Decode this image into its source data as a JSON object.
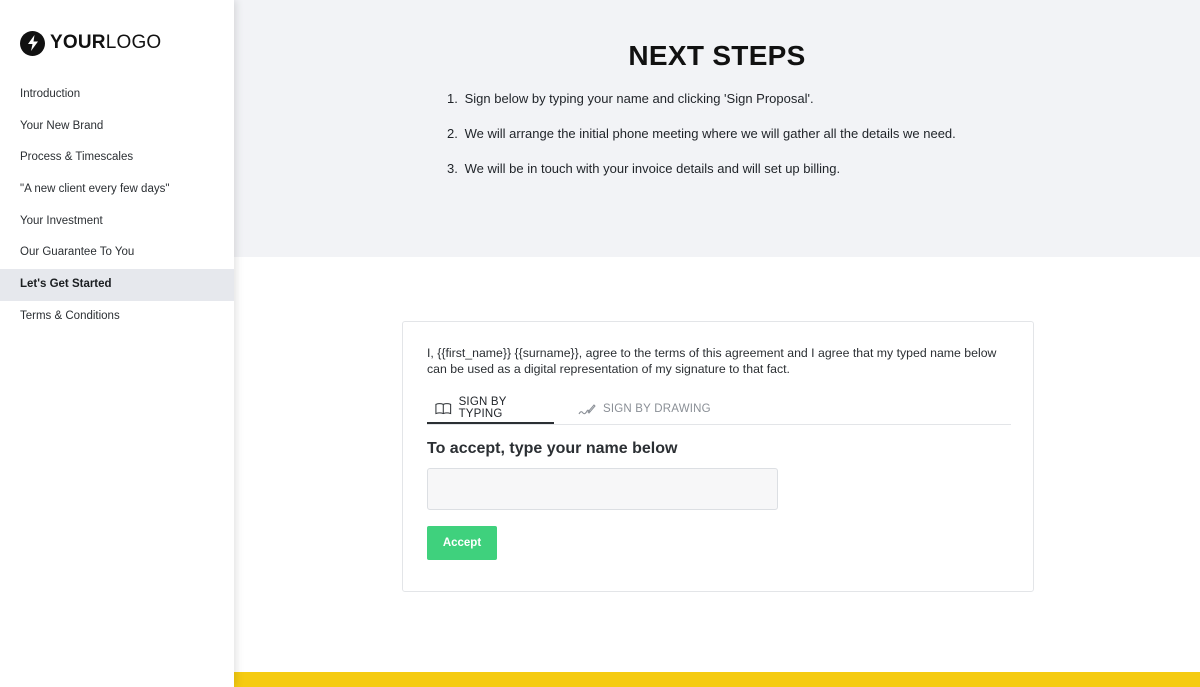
{
  "brand": {
    "logo_bold": "YOUR",
    "logo_light": "LOGO"
  },
  "sidebar": {
    "items": [
      {
        "label": "Introduction"
      },
      {
        "label": "Your New Brand"
      },
      {
        "label": "Process & Timescales"
      },
      {
        "label": "\"A new client every few days\""
      },
      {
        "label": "Your Investment"
      },
      {
        "label": "Our Guarantee To You"
      },
      {
        "label": "Let's Get Started",
        "active": true
      },
      {
        "label": "Terms & Conditions"
      }
    ]
  },
  "main": {
    "title": "NEXT STEPS",
    "steps": [
      {
        "num": "1.",
        "text": "Sign below by typing your name and clicking 'Sign Proposal'."
      },
      {
        "num": "2.",
        "text": "We will arrange the initial phone meeting where we will gather all the details we need."
      },
      {
        "num": "3.",
        "text": "We will be in touch with your invoice details and will set up billing."
      }
    ]
  },
  "signature": {
    "agreement": "I, {{first_name}} {{surname}}, agree to the terms of this agreement and I agree that my typed name below can be used as a digital representation of my signature to that fact.",
    "tab_typing": "SIGN BY TYPING",
    "tab_drawing": "SIGN BY DRAWING",
    "heading": "To accept, type your name below",
    "input_value": "",
    "accept_label": "Accept"
  },
  "colors": {
    "accent_green": "#3fd17d",
    "footer_yellow": "#f5cb11",
    "top_band": "#f2f3f6",
    "active_nav": "#e6e8ed"
  }
}
